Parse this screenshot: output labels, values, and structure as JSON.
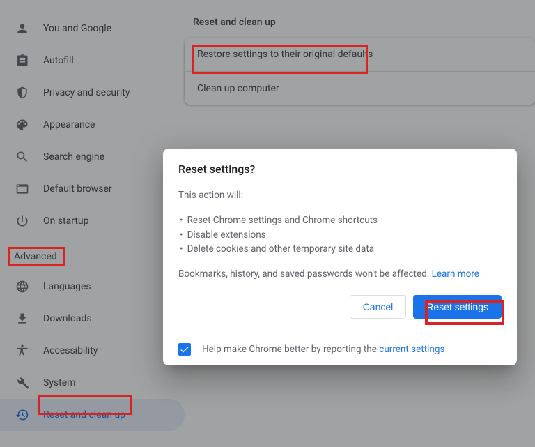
{
  "sidebar": {
    "items": [
      {
        "label": "You and Google"
      },
      {
        "label": "Autofill"
      },
      {
        "label": "Privacy and security"
      },
      {
        "label": "Appearance"
      },
      {
        "label": "Search engine"
      },
      {
        "label": "Default browser"
      },
      {
        "label": "On startup"
      }
    ],
    "advanced_label": "Advanced",
    "advanced_items": [
      {
        "label": "Languages"
      },
      {
        "label": "Downloads"
      },
      {
        "label": "Accessibility"
      },
      {
        "label": "System"
      },
      {
        "label": "Reset and clean up"
      }
    ]
  },
  "main": {
    "section_title": "Reset and clean up",
    "rows": [
      {
        "label": "Restore settings to their original defaults"
      },
      {
        "label": "Clean up computer"
      }
    ]
  },
  "dialog": {
    "title": "Reset settings?",
    "intro": "This action will:",
    "bullets": [
      "Reset Chrome settings and Chrome shortcuts",
      "Disable extensions",
      "Delete cookies and other temporary site data"
    ],
    "note_pre": "Bookmarks, history, and saved passwords won't be affected. ",
    "learn_more": "Learn more",
    "cancel": "Cancel",
    "confirm": "Reset settings",
    "footer_pre": "Help make Chrome better by reporting the ",
    "footer_link": "current settings"
  }
}
